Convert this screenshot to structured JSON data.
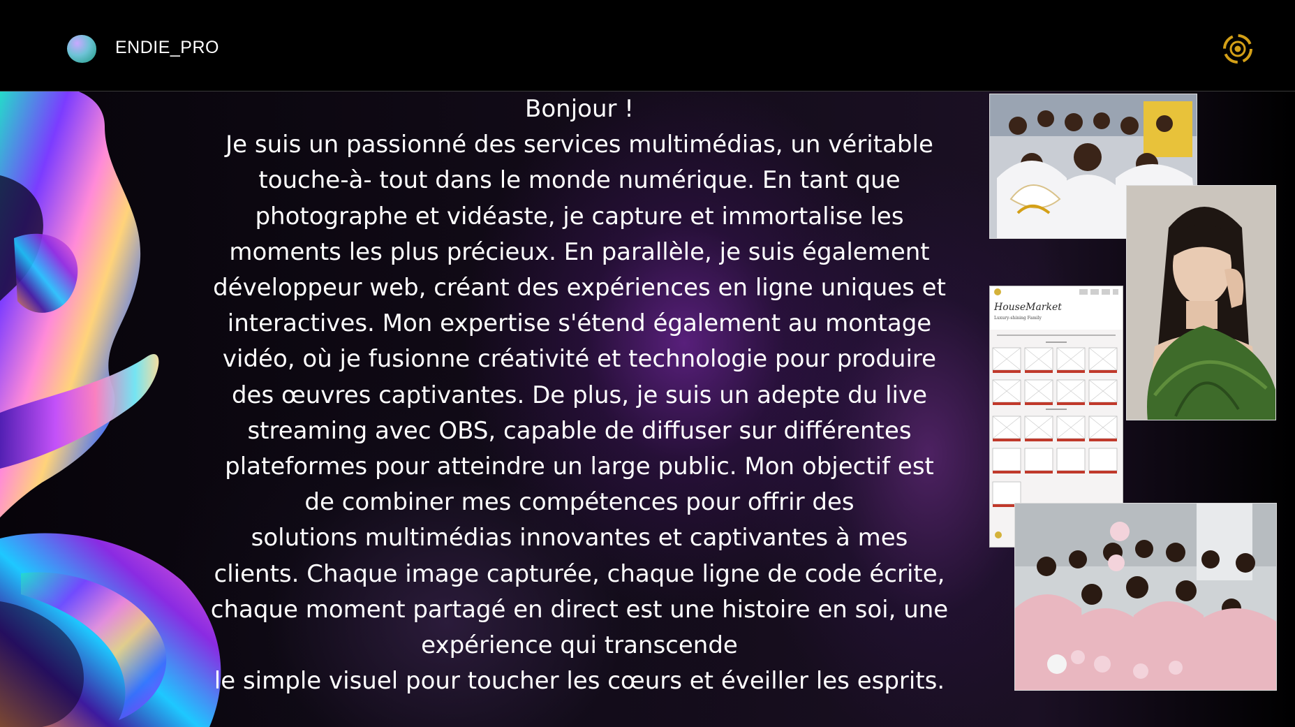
{
  "header": {
    "brand": "ENDIE_PRO",
    "logo_icon": "blob-logo-icon",
    "user_icon": "user-menu-icon",
    "accent_color": "#d4a017"
  },
  "bio": {
    "lines": [
      "Bonjour !",
      "Je suis un passionné des services multimédias, un véritable",
      "touche-à- tout dans le monde numérique. En tant que",
      "photographe et vidéaste, je capture et immortalise les",
      "moments les plus précieux. En parallèle, je suis également",
      "développeur web, créant des expériences en ligne uniques et",
      "interactives. Mon expertise s'étend également au montage",
      "vidéo, où je fusionne créativité et technologie pour produire",
      "des œuvres captivantes. De plus, je suis un adepte du live",
      "streaming avec OBS, capable de diffuser sur différentes",
      "plateformes pour atteindre un large public. Mon objectif est",
      "de combiner mes compétences pour offrir des",
      "solutions multimédias innovantes et captivantes à mes",
      "clients. Chaque image capturée, chaque ligne de code écrite,",
      "chaque moment partagé en direct est une histoire en soi, une",
      "expérience qui transcende",
      "le simple visuel pour toucher les cœurs et éveiller les esprits."
    ]
  },
  "gallery": {
    "mockup": {
      "logo_text": "HouseMarket",
      "tagline": "Luxury-shining Family"
    }
  }
}
